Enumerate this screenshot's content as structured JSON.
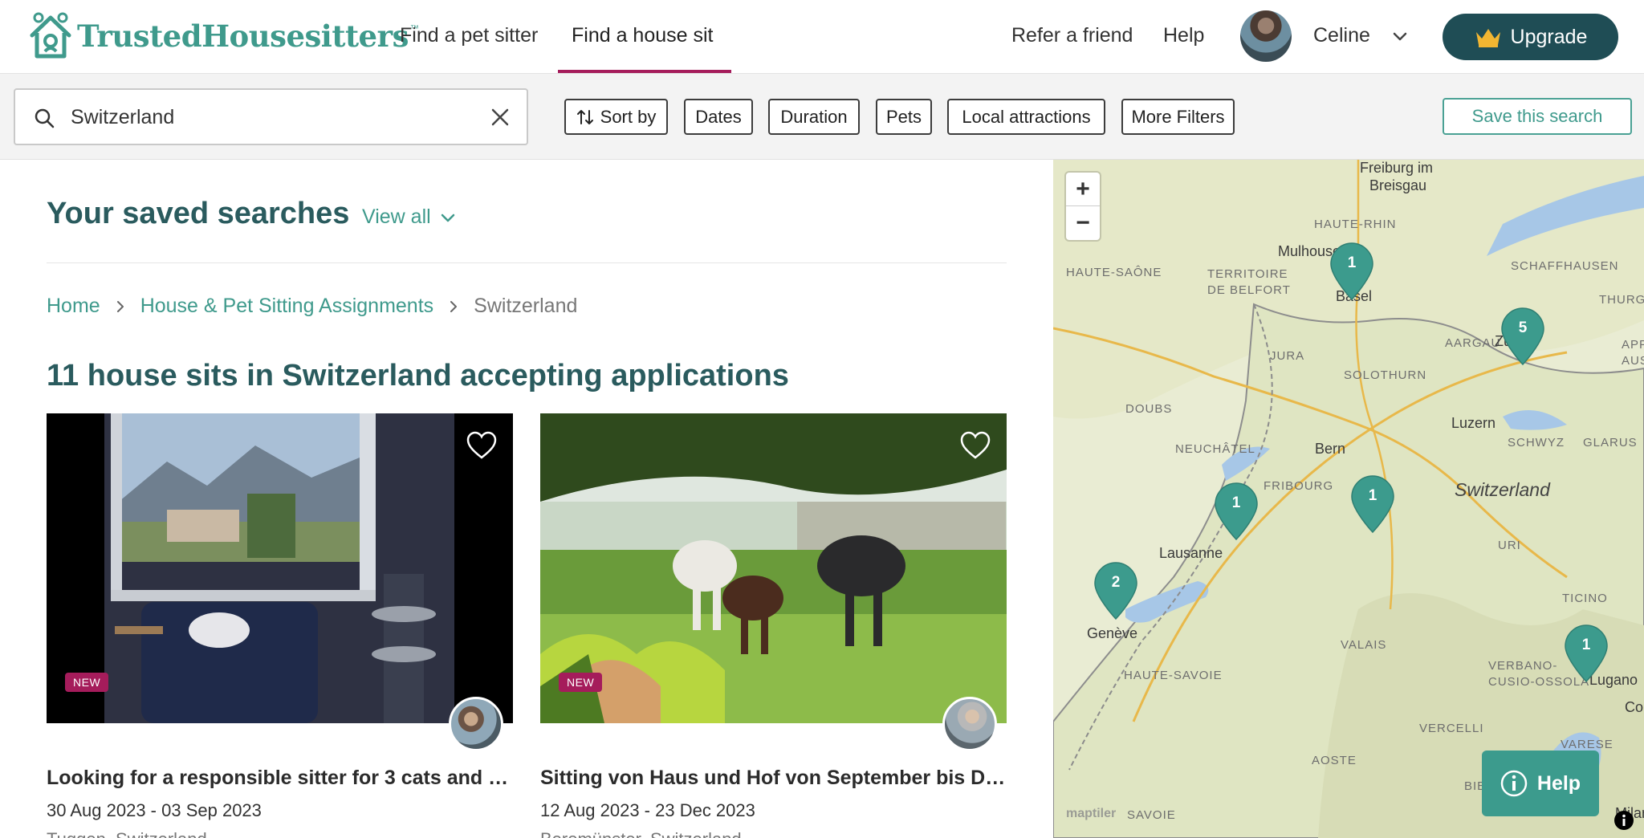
{
  "brand": {
    "name": "TrustedHousesitters",
    "tm": "™",
    "color": "#3f9a8c"
  },
  "nav": {
    "find_pet_sitter": "Find a pet sitter",
    "find_house_sit": "Find a house sit",
    "refer": "Refer a friend",
    "help": "Help",
    "user_name": "Celine",
    "upgrade": "Upgrade"
  },
  "search": {
    "value": "Switzerland",
    "placeholder": ""
  },
  "filters": {
    "sort_by": "Sort by",
    "dates": "Dates",
    "duration": "Duration",
    "pets": "Pets",
    "local_attractions": "Local attractions",
    "more_filters": "More Filters",
    "save_search": "Save this search"
  },
  "saved": {
    "title": "Your saved searches",
    "view_all": "View all"
  },
  "breadcrumb": [
    "Home",
    "House & Pet Sitting Assignments",
    "Switzerland"
  ],
  "results_title": "11 house sits in Switzerland accepting applications",
  "listings": [
    {
      "badge": "NEW",
      "title": "Looking for a responsible sitter for 3 cats and 4 ...",
      "dates": "30 Aug 2023 - 03 Sep 2023",
      "location": "Tuggen, Switzerland"
    },
    {
      "badge": "NEW",
      "title": "Sitting von Haus und Hof von September bis De...",
      "dates": "12 Aug 2023 - 23 Dec 2023",
      "location": "Beromünster, Switzerland"
    }
  ],
  "map": {
    "zoom_in": "+",
    "zoom_out": "−",
    "country": "Switzerland",
    "cities": [
      "Freiburg im",
      "Breisgau",
      "Mulhouse",
      "Basel",
      "Zürich",
      "Luzern",
      "Bern",
      "Lausanne",
      "Genève",
      "Lugano",
      "Como",
      "Milano"
    ],
    "regions": [
      "HAUTE-RHIN",
      "HAUTE-SAÔNE",
      "TERRITOIRE",
      "DE BELFORT",
      "SCHAFFHAUSEN",
      "THURGAU",
      "AARGAU",
      "JURA",
      "SOLOTHURN",
      "DOUBS",
      "NEUCHÂTEL",
      "SCHWYZ",
      "GLARUS",
      "FRIBOURG",
      "URI",
      "TICINO",
      "VALAIS",
      "VERBANO-",
      "CUSIO-OSSOLA",
      "HAUTE-SAVOIE",
      "VARESE",
      "VERCELLI",
      "AOSTE",
      "BIELLA",
      "SAVOIE",
      "APP",
      "AUSS"
    ],
    "pins": [
      "1",
      "5",
      "1",
      "1",
      "2",
      "1"
    ],
    "attribution": "maptiler",
    "help": "Help"
  },
  "colors": {
    "teal_dark": "#1f4d55",
    "teal": "#3f9a8c",
    "accent": "#a51c5b",
    "heading": "#2a5b5e"
  }
}
